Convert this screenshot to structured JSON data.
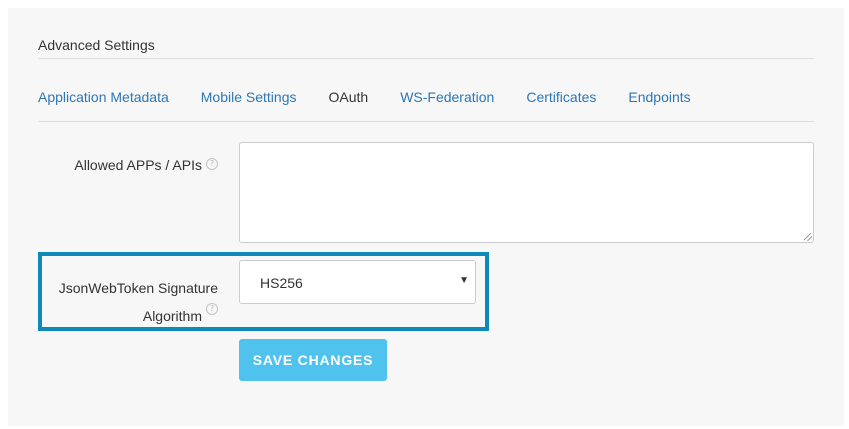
{
  "section": {
    "title": "Advanced Settings"
  },
  "tabs": [
    {
      "label": "Application Metadata",
      "active": false
    },
    {
      "label": "Mobile Settings",
      "active": false
    },
    {
      "label": "OAuth",
      "active": true
    },
    {
      "label": "WS-Federation",
      "active": false
    },
    {
      "label": "Certificates",
      "active": false
    },
    {
      "label": "Endpoints",
      "active": false
    }
  ],
  "fields": {
    "allowed_apps": {
      "label": "Allowed APPs / APIs",
      "value": "",
      "help_icon": "question-circle-icon"
    },
    "jwt_algorithm": {
      "label_line1": "JsonWebToken Signature",
      "label_line2": "Algorithm",
      "value": "HS256",
      "help_icon": "question-circle-icon",
      "highlight_color": "#0d8ab8"
    }
  },
  "actions": {
    "save_label": "SAVE CHANGES"
  },
  "colors": {
    "accent": "#4fc3ee",
    "link": "#2c77b5",
    "highlight": "#0d8ab8"
  }
}
